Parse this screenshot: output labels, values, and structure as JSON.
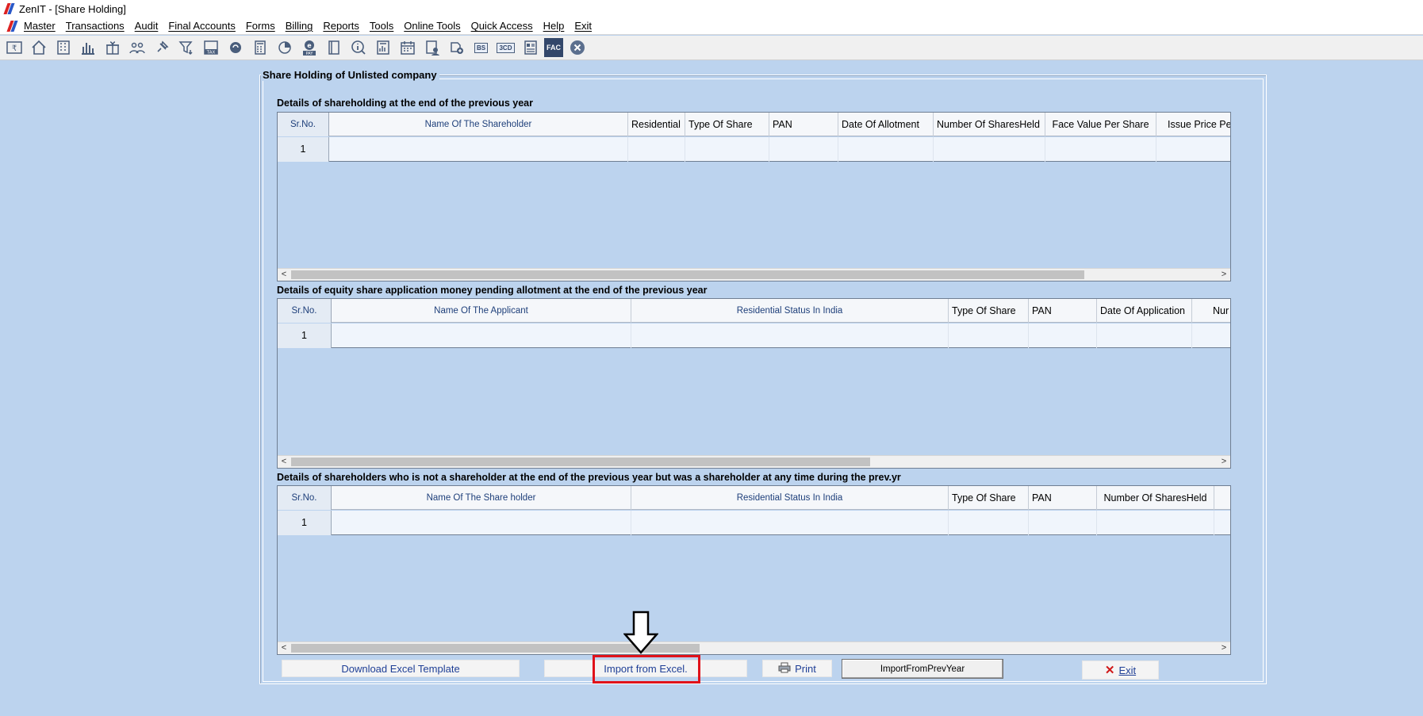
{
  "window": {
    "title": "ZenIT - [Share Holding]"
  },
  "menu": [
    "Master",
    "Transactions",
    "Audit",
    "Final Accounts",
    "Forms",
    "Billing",
    "Reports",
    "Tools",
    "Online Tools",
    "Quick Access",
    "Help",
    "Exit"
  ],
  "toolbar": {
    "icons": [
      "rupee-icon",
      "home-icon",
      "building-icon",
      "bar-chart-icon",
      "gift-icon",
      "users-icon",
      "pin-icon",
      "filter-icon",
      "tax-icon",
      "refresh-icon",
      "calculator-icon",
      "pie-chart-icon",
      "epay-icon",
      "book-icon",
      "info-icon",
      "report-icon",
      "calendar-icon",
      "user-doc-icon",
      "add-icon",
      "bs-icon",
      "3cd-icon",
      "form-icon",
      "fac-icon",
      "close-icon"
    ],
    "labels": {
      "tax": "TAX",
      "pay": "PAY",
      "bs": "BS",
      "cd": "3CD",
      "fac": "FAC"
    }
  },
  "panel": {
    "title": "Share Holding of Unlisted company"
  },
  "sections": [
    {
      "title": "Details of shareholding at the end of the previous year",
      "columns": [
        "Sr.No.",
        "Name Of The Shareholder",
        "Residential",
        "Type Of Share",
        "PAN",
        "Date Of Allotment",
        "Number Of SharesHeld",
        "Face Value Per Share",
        "Issue Price Pe"
      ],
      "rows": [
        [
          "1",
          "",
          "",
          "",
          "",
          "",
          "",
          "",
          ""
        ]
      ]
    },
    {
      "title": "Details of equity share application money pending allotment at the end of the previous year",
      "columns": [
        "Sr.No.",
        "Name Of The Applicant",
        "Residential Status In India",
        "Type Of Share",
        "PAN",
        "Date Of Application",
        "Nur"
      ],
      "rows": [
        [
          "1",
          "",
          "",
          "",
          "",
          "",
          ""
        ]
      ]
    },
    {
      "title": "Details of shareholders who is not a shareholder at the end of the previous year but was a shareholder at any time during the prev.yr",
      "columns": [
        "Sr.No.",
        "Name Of The Share holder",
        "Residential Status In India",
        "Type Of Share",
        "PAN",
        "Number Of SharesHeld",
        ""
      ],
      "rows": [
        [
          "1",
          "",
          "",
          "",
          "",
          "",
          ""
        ]
      ]
    }
  ],
  "buttons": {
    "download_template": "Download Excel Template",
    "import_excel": "Import from Excel.",
    "print": "Print",
    "import_prev_year": "ImportFromPrevYear",
    "exit": "Exit"
  }
}
